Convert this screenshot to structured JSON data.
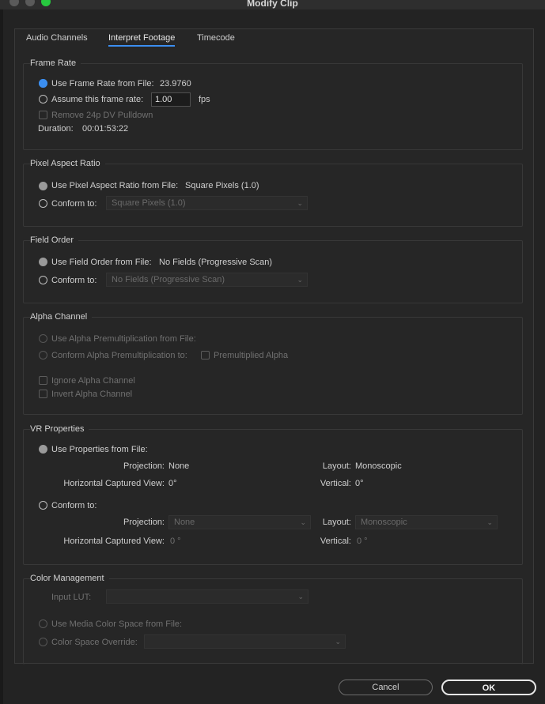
{
  "window": {
    "title": "Modify Clip"
  },
  "tabs": [
    {
      "label": "Audio Channels"
    },
    {
      "label": "Interpret Footage"
    },
    {
      "label": "Timecode"
    }
  ],
  "frame_rate": {
    "title": "Frame Rate",
    "use_file_label": "Use Frame Rate from File:",
    "file_value": "23.9760",
    "assume_label": "Assume this frame rate:",
    "assume_value": "1.00",
    "fps": "fps",
    "pulldown_label": "Remove 24p DV Pulldown",
    "duration_label": "Duration:",
    "duration_value": "00:01:53:22"
  },
  "pixel_aspect": {
    "title": "Pixel Aspect Ratio",
    "use_file_label": "Use Pixel Aspect Ratio from File:",
    "file_value": "Square Pixels (1.0)",
    "conform_label": "Conform to:",
    "conform_value": "Square Pixels (1.0)"
  },
  "field_order": {
    "title": "Field Order",
    "use_file_label": "Use Field Order from File:",
    "file_value": "No Fields (Progressive Scan)",
    "conform_label": "Conform to:",
    "conform_value": "No Fields (Progressive Scan)"
  },
  "alpha": {
    "title": "Alpha Channel",
    "use_file_label": "Use Alpha Premultiplication from File:",
    "conform_label": "Conform Alpha Premultiplication to:",
    "premult_label": "Premultiplied Alpha",
    "ignore_label": "Ignore Alpha Channel",
    "invert_label": "Invert Alpha Channel"
  },
  "vr": {
    "title": "VR Properties",
    "use_file_label": "Use Properties from File:",
    "projection_label": "Projection:",
    "projection_value": "None",
    "layout_label": "Layout:",
    "layout_value": "Monoscopic",
    "hcv_label": "Horizontal Captured View:",
    "hcv_value": "0°",
    "vertical_label": "Vertical:",
    "vertical_value": "0°",
    "conform_label": "Conform to:",
    "conform_projection_value": "None",
    "conform_layout_value": "Monoscopic",
    "conform_hcv_value": "0 °",
    "conform_vertical_value": "0 °"
  },
  "color": {
    "title": "Color Management",
    "lut_label": "Input LUT:",
    "lut_value": "",
    "use_media_label": "Use Media Color Space from File:",
    "override_label": "Color Space Override:",
    "override_value": ""
  },
  "buttons": {
    "cancel": "Cancel",
    "ok": "OK"
  },
  "colors": {
    "accent": "#3b8ef0",
    "background": "#232323"
  }
}
